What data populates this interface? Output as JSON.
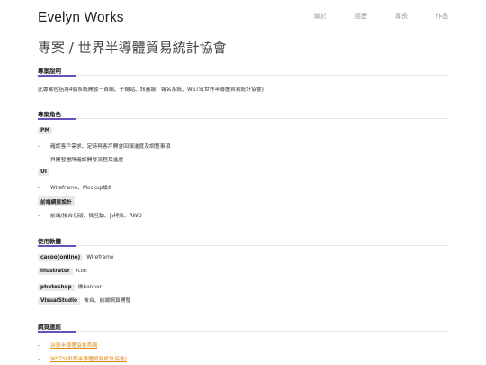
{
  "brand": "Evelyn Works",
  "nav": [
    "關於",
    "經歷",
    "專長",
    "作品"
  ],
  "page_title": "專案 / 世界半導體貿易統計協會",
  "sections": {
    "desc": {
      "heading": "專案說明",
      "text": "此專案包括為4個系統開發－首網、子網站、訊審報、報名系統、WSTS(世界半導體貿易統計協會)"
    },
    "role": {
      "heading": "專案角色",
      "pm_tag": "PM",
      "pm_items": [
        "確認客戶需求、定時與客戶開會回報進度及調整事項",
        "與開發團隊確認開發流程及進度"
      ],
      "ui_tag": "UI",
      "ui_items": [
        "Wireframe、Mockup設計"
      ],
      "fe_tag": "前端網頁設計",
      "fe_items": [
        "前端/後台切版、微互動、js特效、RWD"
      ]
    },
    "software": {
      "heading": "使用軟體",
      "items": [
        {
          "tag": "cacoo(online)",
          "desc": "Wireframe"
        },
        {
          "tag": "illustrator",
          "desc": "icon"
        },
        {
          "tag": "photoshop",
          "desc": "做banner"
        },
        {
          "tag": "VisualStudio",
          "desc": "後台、前端網頁開發"
        }
      ]
    },
    "links": {
      "heading": "網頁連結",
      "items": [
        "台灣半導體協會首網",
        "WSTS(世界半導體貿易統計協會)"
      ]
    }
  },
  "colors": {
    "accent": "#6b4fbb",
    "link": "#e08a1e",
    "tag_bg": "#e9e9e9"
  }
}
